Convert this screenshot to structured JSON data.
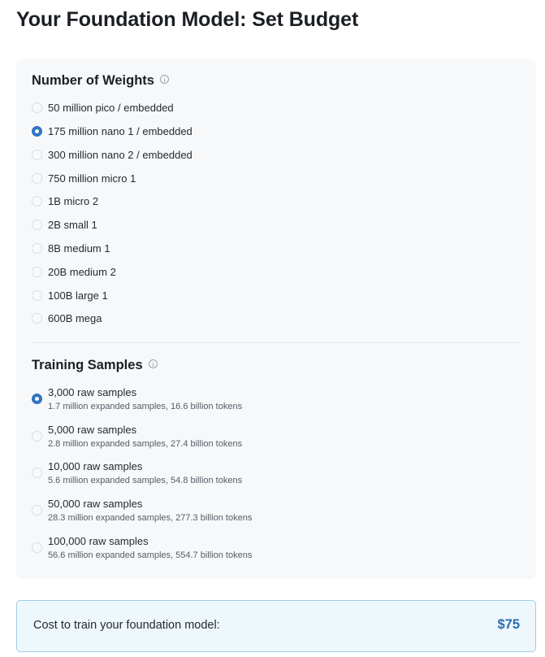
{
  "page": {
    "title": "Your Foundation Model: Set Budget"
  },
  "weights": {
    "title": "Number of Weights",
    "info_icon": "info-icon",
    "selected_index": 1,
    "options": [
      {
        "label": "50 million pico / embedded"
      },
      {
        "label": "175 million nano 1 / embedded"
      },
      {
        "label": "300 million nano 2 / embedded"
      },
      {
        "label": "750 million micro 1"
      },
      {
        "label": "1B micro 2"
      },
      {
        "label": "2B small 1"
      },
      {
        "label": "8B medium 1"
      },
      {
        "label": "20B medium 2"
      },
      {
        "label": "100B large 1"
      },
      {
        "label": "600B mega"
      }
    ]
  },
  "samples": {
    "title": "Training Samples",
    "info_icon": "info-icon",
    "selected_index": 0,
    "options": [
      {
        "label": "3,000 raw samples",
        "detail": "1.7 million expanded samples, 16.6 billion tokens"
      },
      {
        "label": "5,000 raw samples",
        "detail": "2.8 million expanded samples, 27.4 billion tokens"
      },
      {
        "label": "10,000 raw samples",
        "detail": "5.6 million expanded samples, 54.8 billion tokens"
      },
      {
        "label": "50,000 raw samples",
        "detail": "28.3 million expanded samples, 277.3 billion tokens"
      },
      {
        "label": "100,000 raw samples",
        "detail": "56.6 million expanded samples, 554.7 billion tokens"
      }
    ]
  },
  "cost": {
    "label": "Cost to train your foundation model:",
    "value": "$75"
  },
  "colors": {
    "accent": "#2f74c0",
    "cost_value": "#2a6db0",
    "panel_bg": "#f6f8fa",
    "cost_bg": "#eef7fc",
    "cost_border": "#9fcde6"
  }
}
